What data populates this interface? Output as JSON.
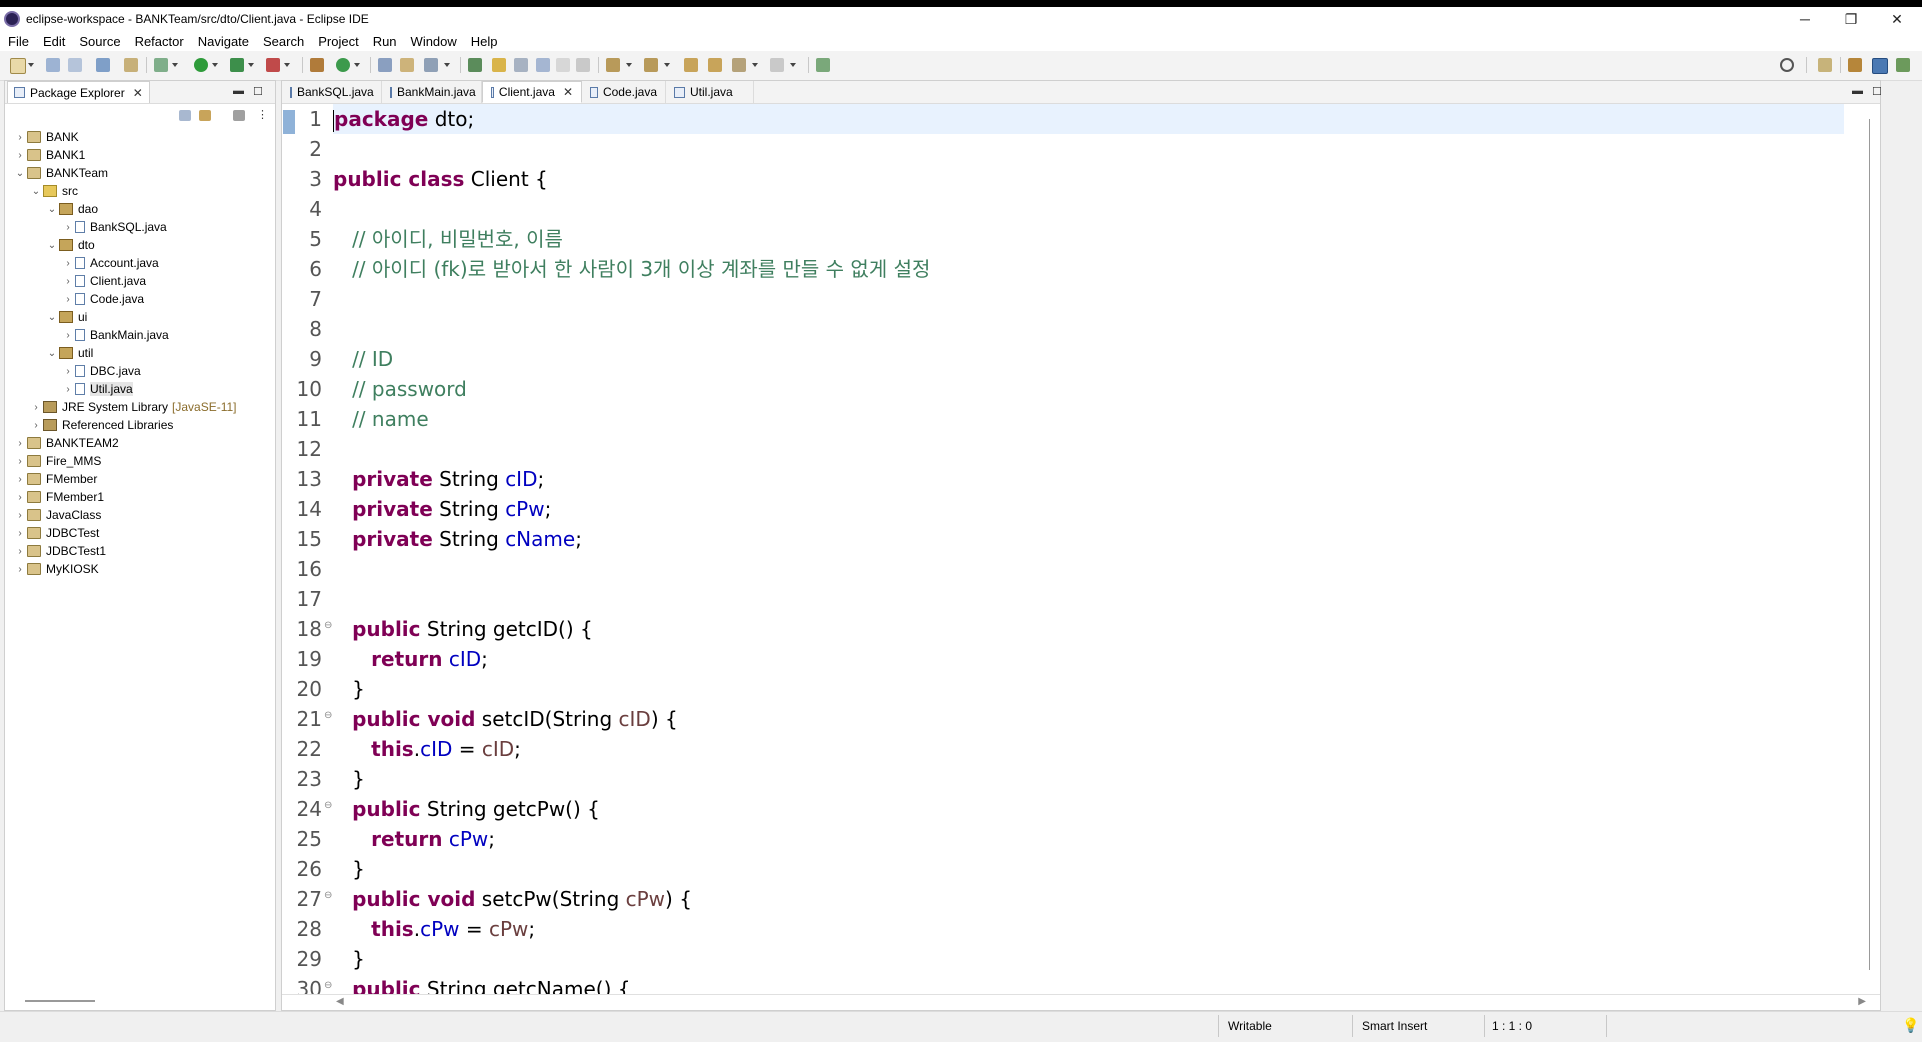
{
  "window": {
    "title": "eclipse-workspace - BANKTeam/src/dto/Client.java - Eclipse IDE"
  },
  "menu": [
    "File",
    "Edit",
    "Source",
    "Refactor",
    "Navigate",
    "Search",
    "Project",
    "Run",
    "Window",
    "Help"
  ],
  "package_explorer": {
    "title": "Package Explorer",
    "tree": [
      {
        "label": "BANK",
        "depth": 0,
        "twisty": ">",
        "icon": "project"
      },
      {
        "label": "BANK1",
        "depth": 0,
        "twisty": ">",
        "icon": "project"
      },
      {
        "label": "BANKTeam",
        "depth": 0,
        "twisty": "v",
        "icon": "project"
      },
      {
        "label": "src",
        "depth": 1,
        "twisty": "v",
        "icon": "folder"
      },
      {
        "label": "dao",
        "depth": 2,
        "twisty": "v",
        "icon": "package"
      },
      {
        "label": "BankSQL.java",
        "depth": 3,
        "twisty": ">",
        "icon": "java"
      },
      {
        "label": "dto",
        "depth": 2,
        "twisty": "v",
        "icon": "package"
      },
      {
        "label": "Account.java",
        "depth": 3,
        "twisty": ">",
        "icon": "java"
      },
      {
        "label": "Client.java",
        "depth": 3,
        "twisty": ">",
        "icon": "java"
      },
      {
        "label": "Code.java",
        "depth": 3,
        "twisty": ">",
        "icon": "java"
      },
      {
        "label": "ui",
        "depth": 2,
        "twisty": "v",
        "icon": "package"
      },
      {
        "label": "BankMain.java",
        "depth": 3,
        "twisty": ">",
        "icon": "java"
      },
      {
        "label": "util",
        "depth": 2,
        "twisty": "v",
        "icon": "package"
      },
      {
        "label": "DBC.java",
        "depth": 3,
        "twisty": ">",
        "icon": "java"
      },
      {
        "label": "Util.java",
        "depth": 3,
        "twisty": ">",
        "icon": "java",
        "selected": true
      },
      {
        "label": "JRE System Library",
        "extra": "[JavaSE-11]",
        "depth": 1,
        "twisty": ">",
        "icon": "library"
      },
      {
        "label": "Referenced Libraries",
        "depth": 1,
        "twisty": ">",
        "icon": "library"
      },
      {
        "label": "BANKTEAM2",
        "depth": 0,
        "twisty": ">",
        "icon": "project"
      },
      {
        "label": "Fire_MMS",
        "depth": 0,
        "twisty": ">",
        "icon": "project"
      },
      {
        "label": "FMember",
        "depth": 0,
        "twisty": ">",
        "icon": "project"
      },
      {
        "label": "FMember1",
        "depth": 0,
        "twisty": ">",
        "icon": "project"
      },
      {
        "label": "JavaClass",
        "depth": 0,
        "twisty": ">",
        "icon": "project"
      },
      {
        "label": "JDBCTest",
        "depth": 0,
        "twisty": ">",
        "icon": "project"
      },
      {
        "label": "JDBCTest1",
        "depth": 0,
        "twisty": ">",
        "icon": "project"
      },
      {
        "label": "MyKIOSK",
        "depth": 0,
        "twisty": ">",
        "icon": "project"
      }
    ]
  },
  "editor": {
    "tabs": [
      {
        "label": "BankSQL.java",
        "active": false
      },
      {
        "label": "BankMain.java",
        "active": false
      },
      {
        "label": "Client.java",
        "active": true
      },
      {
        "label": "Code.java",
        "active": false
      },
      {
        "label": "Util.java",
        "active": false
      }
    ],
    "lines": [
      {
        "n": "1",
        "fold": "",
        "tokens": [
          [
            "kw",
            "package"
          ],
          [
            "",
            "dto;"
          ]
        ]
      },
      {
        "n": "2",
        "fold": "",
        "tokens": []
      },
      {
        "n": "3",
        "fold": "",
        "tokens": [
          [
            "kw",
            "public class"
          ],
          [
            "",
            "Client {"
          ]
        ]
      },
      {
        "n": "4",
        "fold": "",
        "tokens": []
      },
      {
        "n": "5",
        "fold": "",
        "tokens": [
          [
            "cm",
            "   // 아이디, 비밀번호, 이름"
          ]
        ]
      },
      {
        "n": "6",
        "fold": "",
        "tokens": [
          [
            "cm",
            "   // 아이디 (fk)로 받아서 한 사람이 3개 이상 계좌를 만들 수 없게 설정"
          ]
        ]
      },
      {
        "n": "7",
        "fold": "",
        "tokens": []
      },
      {
        "n": "8",
        "fold": "",
        "tokens": []
      },
      {
        "n": "9",
        "fold": "",
        "tokens": [
          [
            "cm",
            "   // ID"
          ]
        ]
      },
      {
        "n": "10",
        "fold": "",
        "tokens": [
          [
            "cm",
            "   // password"
          ]
        ]
      },
      {
        "n": "11",
        "fold": "",
        "tokens": [
          [
            "cm",
            "   // name"
          ]
        ]
      },
      {
        "n": "12",
        "fold": "",
        "tokens": []
      },
      {
        "n": "13",
        "fold": "",
        "tokens": [
          [
            "",
            "   "
          ],
          [
            "kw",
            "private"
          ],
          [
            "",
            " String "
          ],
          [
            "fld",
            "cID"
          ],
          [
            "",
            ";"
          ]
        ]
      },
      {
        "n": "14",
        "fold": "",
        "tokens": [
          [
            "",
            "   "
          ],
          [
            "kw",
            "private"
          ],
          [
            "",
            " String "
          ],
          [
            "fld",
            "cPw"
          ],
          [
            "",
            ";"
          ]
        ]
      },
      {
        "n": "15",
        "fold": "",
        "tokens": [
          [
            "",
            "   "
          ],
          [
            "kw",
            "private"
          ],
          [
            "",
            " String "
          ],
          [
            "fld",
            "cName"
          ],
          [
            "",
            ";"
          ]
        ]
      },
      {
        "n": "16",
        "fold": "",
        "tokens": []
      },
      {
        "n": "17",
        "fold": "",
        "tokens": []
      },
      {
        "n": "18",
        "fold": "⊖",
        "tokens": [
          [
            "",
            "   "
          ],
          [
            "kw",
            "public"
          ],
          [
            "",
            " String getcID() {"
          ]
        ]
      },
      {
        "n": "19",
        "fold": "",
        "tokens": [
          [
            "",
            "      "
          ],
          [
            "kw",
            "return"
          ],
          [
            "",
            " "
          ],
          [
            "fld",
            "cID"
          ],
          [
            "",
            ";"
          ]
        ]
      },
      {
        "n": "20",
        "fold": "",
        "tokens": [
          [
            "",
            "   }"
          ]
        ]
      },
      {
        "n": "21",
        "fold": "⊖",
        "tokens": [
          [
            "",
            "   "
          ],
          [
            "kw",
            "public void"
          ],
          [
            "",
            " setcID(String "
          ],
          [
            "prm",
            "cID"
          ],
          [
            "",
            ") {"
          ]
        ]
      },
      {
        "n": "22",
        "fold": "",
        "tokens": [
          [
            "",
            "      "
          ],
          [
            "kw",
            "this"
          ],
          [
            "",
            "."
          ],
          [
            "fld",
            "cID"
          ],
          [
            "",
            " = "
          ],
          [
            "prm",
            "cID"
          ],
          [
            "",
            ";"
          ]
        ]
      },
      {
        "n": "23",
        "fold": "",
        "tokens": [
          [
            "",
            "   }"
          ]
        ]
      },
      {
        "n": "24",
        "fold": "⊖",
        "tokens": [
          [
            "",
            "   "
          ],
          [
            "kw",
            "public"
          ],
          [
            "",
            " String getcPw() {"
          ]
        ]
      },
      {
        "n": "25",
        "fold": "",
        "tokens": [
          [
            "",
            "      "
          ],
          [
            "kw",
            "return"
          ],
          [
            "",
            " "
          ],
          [
            "fld",
            "cPw"
          ],
          [
            "",
            ";"
          ]
        ]
      },
      {
        "n": "26",
        "fold": "",
        "tokens": [
          [
            "",
            "   }"
          ]
        ]
      },
      {
        "n": "27",
        "fold": "⊖",
        "tokens": [
          [
            "",
            "   "
          ],
          [
            "kw",
            "public void"
          ],
          [
            "",
            " setcPw(String "
          ],
          [
            "prm",
            "cPw"
          ],
          [
            "",
            ") {"
          ]
        ]
      },
      {
        "n": "28",
        "fold": "",
        "tokens": [
          [
            "",
            "      "
          ],
          [
            "kw",
            "this"
          ],
          [
            "",
            "."
          ],
          [
            "fld",
            "cPw"
          ],
          [
            "",
            " = "
          ],
          [
            "prm",
            "cPw"
          ],
          [
            "",
            ";"
          ]
        ]
      },
      {
        "n": "29",
        "fold": "",
        "tokens": [
          [
            "",
            "   }"
          ]
        ]
      },
      {
        "n": "30",
        "fold": "⊖",
        "tokens": [
          [
            "",
            "   "
          ],
          [
            "kw",
            "public"
          ],
          [
            "",
            " String getcName() {"
          ]
        ]
      }
    ]
  },
  "status": {
    "writable": "Writable",
    "insert_mode": "Smart Insert",
    "position": "1 : 1 : 0"
  },
  "window_controls": {
    "minimize": "─",
    "restore": "❐",
    "close": "✕"
  },
  "colors": {
    "keyword": "#7f0055",
    "comment": "#3f7f5f",
    "field": "#0000c0",
    "parameter": "#6a3e3e",
    "current_line": "#e8f2fe"
  }
}
